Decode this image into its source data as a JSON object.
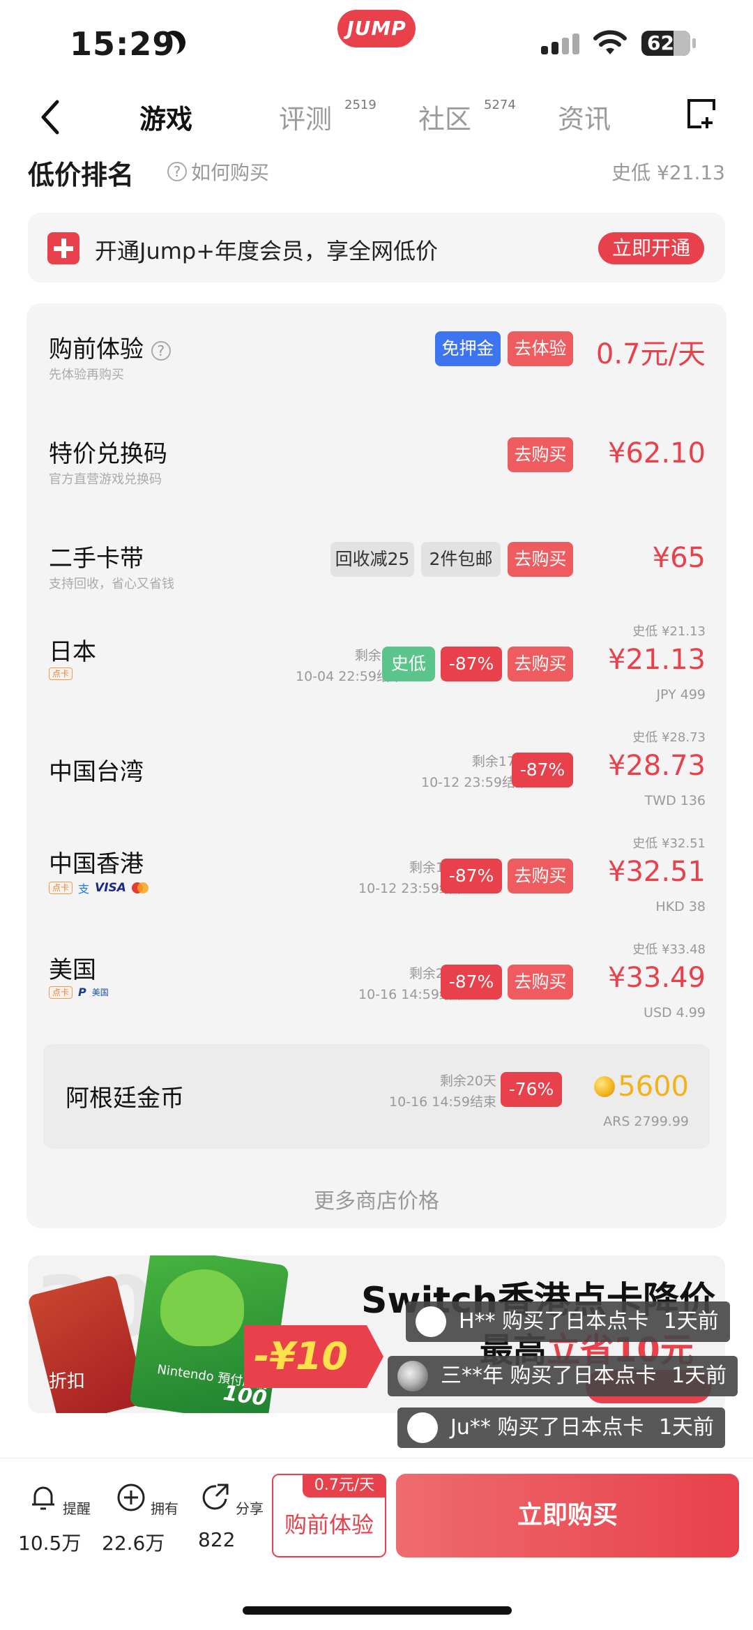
{
  "status": {
    "time": "15:29",
    "battery": "62",
    "app_logo": "JUMP"
  },
  "nav": {
    "tabs": [
      {
        "label": "游戏",
        "count": ""
      },
      {
        "label": "评测",
        "count": "2519"
      },
      {
        "label": "社区",
        "count": "5274"
      },
      {
        "label": "资讯",
        "count": ""
      }
    ]
  },
  "header": {
    "title": "低价排名",
    "help": "如何购买",
    "lowest": "史低 ¥21.13"
  },
  "member": {
    "text": "开通Jump+年度会员，享全网低价",
    "button": "立即开通"
  },
  "rows": [
    {
      "name": "购前体验",
      "sub": "先体验再购买",
      "tags": [
        "免押金",
        "去体验"
      ],
      "price": "0.7元/天"
    },
    {
      "name": "特价兑换码",
      "sub": "官方直营游戏兑换码",
      "tags": [
        "去购买"
      ],
      "price": "¥62.10"
    },
    {
      "name": "二手卡带",
      "sub": "支持回收，省心又省钱",
      "tags": [
        "回收减25",
        "2件包邮",
        "去购买"
      ],
      "price": "¥65"
    },
    {
      "name": "日本",
      "remain": "剩余9天",
      "end": "10-04 22:59结束",
      "tags": [
        "史低",
        "-87%",
        "去购买"
      ],
      "hist": "史低 ¥21.13",
      "price": "¥21.13",
      "cur": "JPY 499"
    },
    {
      "name": "中国台湾",
      "remain": "剩余17天",
      "end": "10-12 23:59结束",
      "tags": [
        "-87%"
      ],
      "hist": "史低 ¥28.73",
      "price": "¥28.73",
      "cur": "TWD 136"
    },
    {
      "name": "中国香港",
      "remain": "剩余17天",
      "end": "10-12 23:59结束",
      "tags": [
        "-87%",
        "去购买"
      ],
      "hist": "史低 ¥32.51",
      "price": "¥32.51",
      "cur": "HKD 38"
    },
    {
      "name": "美国",
      "remain": "剩余20天",
      "end": "10-16 14:59结束",
      "tags": [
        "-87%",
        "去购买"
      ],
      "hist": "史低 ¥33.48",
      "price": "¥33.49",
      "cur": "USD 4.99"
    },
    {
      "name": "阿根廷金币",
      "remain": "剩余20天",
      "end": "10-16 14:59结束",
      "tags": [
        "-76%"
      ],
      "price": "5600",
      "cur": "ARS 2799.99"
    }
  ],
  "pay_badges": {
    "card": "点卡",
    "visa": "VISA",
    "paypal": "P",
    "us": "美国",
    "alipay": "支"
  },
  "more": "更多商店价格",
  "promo": {
    "bg": "300",
    "title": "Switch香港点卡降价",
    "sub_prefix": "最高",
    "sub_red": "立省10元",
    "discount": "-¥10",
    "corner": "折扣",
    "card_label": "Nintendo 預付序號",
    "card_value": "100"
  },
  "toasts": [
    {
      "user": "H**",
      "text": "购买了日本点卡",
      "time": "1天前"
    },
    {
      "user": "三**年",
      "text": "购买了日本点卡",
      "time": "1天前"
    },
    {
      "user": "Ju**",
      "text": "购买了日本点卡",
      "time": "1天前"
    }
  ],
  "bottom": {
    "remind": {
      "label": "提醒",
      "count": "10.5万"
    },
    "own": {
      "label": "拥有",
      "count": "22.6万"
    },
    "share": {
      "label": "分享",
      "count": "822"
    },
    "try_price": "0.7元/天",
    "try_label": "购前体验",
    "buy": "立即购买"
  },
  "colors": {
    "accent": "#e8414b",
    "blue": "#3d74f0",
    "green": "#5ac48b",
    "gold": "#f2b21c"
  }
}
